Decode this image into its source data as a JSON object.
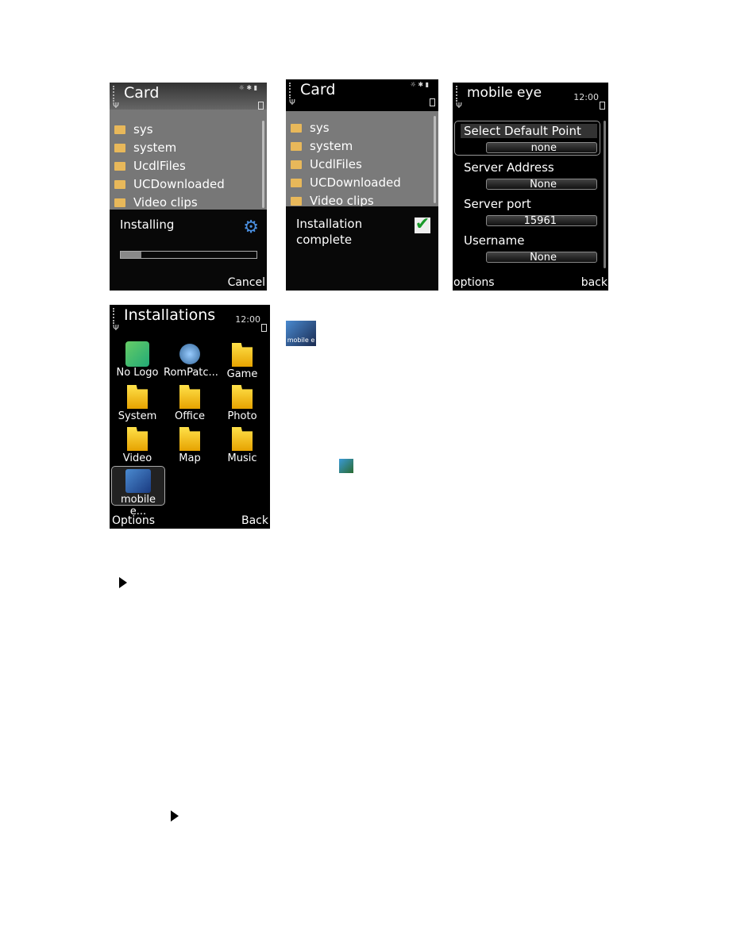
{
  "screen1": {
    "title": "Card",
    "files": [
      "sys",
      "system",
      "UcdlFiles",
      "UCDownloaded",
      "Video clips"
    ],
    "dialog_text": "Installing",
    "progress": 0.15,
    "softkey_right": "Cancel"
  },
  "screen2": {
    "title": "Card",
    "files": [
      "sys",
      "system",
      "UcdlFiles",
      "UCDownloaded",
      "Video clips"
    ],
    "dialog_line1": "Installation",
    "dialog_line2": "complete"
  },
  "screen3": {
    "title": "mobile eye",
    "time": "12:00",
    "fields": [
      {
        "label": "Select Default Point",
        "value": "none"
      },
      {
        "label": "Server Address",
        "value": "None"
      },
      {
        "label": "Server port",
        "value": "15961"
      },
      {
        "label": "Username",
        "value": "None"
      }
    ],
    "softkey_left": "options",
    "softkey_right": "back"
  },
  "screen4": {
    "title": "Installations",
    "time": "12:00",
    "apps": [
      "No Logo",
      "RomPatc...",
      "Game",
      "System",
      "Office",
      "Photo",
      "Video",
      "Map",
      "Music",
      "mobile e..."
    ],
    "softkey_left": "Options",
    "softkey_right": "Back"
  },
  "icon_small_label": "mobile e"
}
